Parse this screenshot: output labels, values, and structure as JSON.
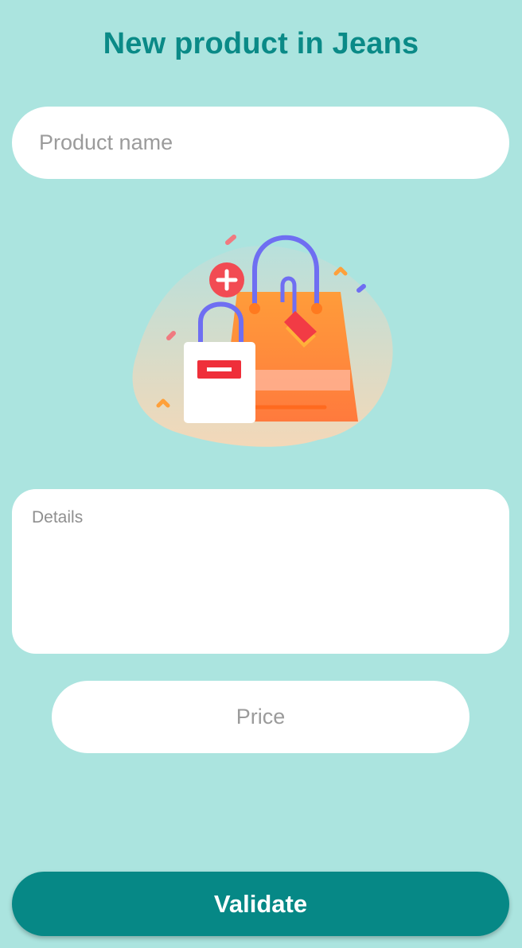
{
  "header": {
    "title": "New product in Jeans"
  },
  "form": {
    "name_placeholder": "Product name",
    "name_value": "",
    "details_placeholder": "Details",
    "details_value": "",
    "price_placeholder": "Price",
    "price_value": ""
  },
  "illustration": {
    "icon": "shopping-bag-illustration"
  },
  "actions": {
    "validate_label": "Validate"
  },
  "colors": {
    "background": "#abe4df",
    "accent": "#068886",
    "title": "#0a8a87",
    "bag_orange": "#ff8a3d",
    "bag_handle": "#6f6ef2",
    "tag_red": "#f23b45"
  }
}
